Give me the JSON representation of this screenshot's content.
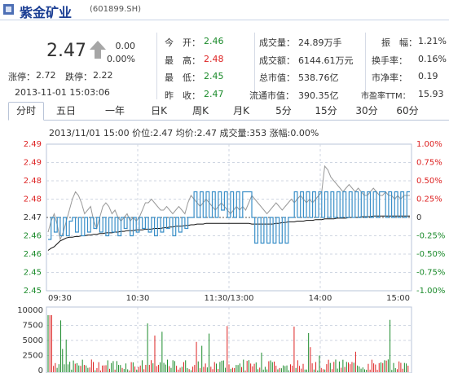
{
  "header": {
    "name": "紫金矿业",
    "code": "(601899.SH)"
  },
  "quote": {
    "price": "2.47",
    "change": "0.00",
    "change_pct": "0.00%",
    "limit_up_label": "涨停：",
    "limit_up": "2.72",
    "limit_down_label": "跌停：",
    "limit_down": "2.22",
    "datetime": "2013-11-01 15:03:06"
  },
  "stats_left": [
    {
      "label": "今　开：",
      "value": "2.46",
      "color": "green"
    },
    {
      "label": "最　高：",
      "value": "2.48",
      "color": "red"
    },
    {
      "label": "最　低：",
      "value": "2.45",
      "color": "green"
    },
    {
      "label": "昨　收：",
      "value": "2.47",
      "color": "green"
    }
  ],
  "stats_mid": [
    {
      "label": "成交量：",
      "value": "24.89万手"
    },
    {
      "label": "成交额：",
      "value": "6144.61万元"
    },
    {
      "label": "总市值：",
      "value": "538.76亿"
    },
    {
      "label": "流通市值：",
      "value": "390.35亿"
    }
  ],
  "stats_right": [
    {
      "label": "振　幅：",
      "value": "1.21%"
    },
    {
      "label": "换手率：",
      "value": "0.16%"
    },
    {
      "label": "市净率：",
      "value": "0.19"
    },
    {
      "label": "市盈率TTM：",
      "value": "15.93"
    }
  ],
  "tabs": [
    "分时",
    "五日",
    "一年",
    "日K",
    "周K",
    "月K",
    "5分",
    "15分",
    "30分",
    "60分"
  ],
  "active_tab": 0,
  "info_line": "2013/11/01 15:00  价位:2.47  均价:2.47  成交量:353  涨幅:0.00%",
  "colors": {
    "up": "#dd2222",
    "down": "#1a8a2a",
    "price_line": "#3a8fc8",
    "avg_line": "#111111",
    "prev_line": "#999999",
    "grid": "#cfd6e2"
  },
  "chart_data": [
    {
      "type": "line",
      "title": "",
      "x_ticks": [
        "09:30",
        "10:30",
        "11:30/13:00",
        "14:00",
        "15:00"
      ],
      "y_left_ticks": [
        "2.49",
        "2.49",
        "2.48",
        "2.48",
        "2.47",
        "2.46",
        "2.46",
        "2.45",
        "2.45"
      ],
      "y_right_ticks": [
        "1.00%",
        "0.75%",
        "0.50%",
        "0.25%",
        "0",
        "-0.25%",
        "-0.50%",
        "-0.75%",
        "-1.00%"
      ],
      "ylim_pct": [
        -1.0,
        1.0
      ],
      "baseline_price": 2.47,
      "series": [
        {
          "values_pct": [
            -0.3,
            0.0,
            -0.2,
            0.0,
            -0.25,
            0.0,
            -0.25,
            -0.05,
            0.0,
            -0.2,
            0.0,
            -0.25,
            0.0,
            -0.2,
            0.0,
            -0.15,
            0.0,
            -0.2,
            0.0,
            -0.25,
            0.0,
            -0.2,
            0.0,
            -0.25,
            0.0,
            -0.15,
            0.0,
            -0.25,
            0.0,
            -0.2,
            0.0,
            -0.15,
            0.0,
            -0.2,
            0.0,
            -0.25,
            0.0,
            -0.2,
            0.0,
            -0.15,
            0.0,
            -0.25,
            0.0,
            -0.2,
            0.0,
            -0.15,
            0.0,
            0.0,
            0.35,
            0.0,
            0.35,
            0.0,
            0.35,
            0.0,
            0.35,
            0.0,
            0.35,
            0.1,
            0.35,
            0.0,
            0.35,
            0.0,
            0.35,
            0.0,
            0.35,
            0.35,
            0.35,
            0.0,
            -0.35,
            0.0,
            -0.35,
            0.0,
            -0.35,
            0.0,
            -0.35,
            0.0,
            -0.35,
            0.0,
            -0.35,
            0.0,
            0.0,
            0.35,
            0.0,
            0.35,
            0.0,
            0.35,
            0.0,
            0.35,
            0.0,
            0.35,
            0.0,
            0.35,
            0.0,
            0.35,
            0.0,
            0.35,
            0.0,
            0.35,
            0.0,
            0.35,
            0.0,
            0.35,
            0.0,
            0.35,
            0.0,
            0.35,
            0.0,
            0.35,
            0.0,
            0.35,
            0.35,
            0.0,
            0.35,
            0.0,
            0.35,
            0.0,
            0.35,
            0.0,
            0.35,
            0.35
          ]
        },
        {
          "values_pct": [
            -0.45,
            -0.42,
            -0.4,
            -0.36,
            -0.32,
            -0.3,
            -0.28,
            -0.27,
            -0.27,
            -0.26,
            -0.26,
            -0.25,
            -0.25,
            -0.24,
            -0.24,
            -0.23,
            -0.23,
            -0.22,
            -0.22,
            -0.21,
            -0.21,
            -0.21,
            -0.2,
            -0.2,
            -0.19,
            -0.19,
            -0.18,
            -0.18,
            -0.18,
            -0.17,
            -0.17,
            -0.17,
            -0.16,
            -0.16,
            -0.16,
            -0.15,
            -0.15,
            -0.15,
            -0.14,
            -0.14,
            -0.13,
            -0.13,
            -0.12,
            -0.12,
            -0.12,
            -0.11,
            -0.11,
            -0.1,
            -0.1,
            -0.09,
            -0.09,
            -0.09,
            -0.08,
            -0.08,
            -0.08,
            -0.08,
            -0.08,
            -0.08,
            -0.08,
            -0.08,
            -0.08,
            -0.08,
            -0.08,
            -0.08,
            -0.08,
            -0.08,
            -0.08,
            -0.09,
            -0.09,
            -0.09,
            -0.09,
            -0.09,
            -0.09,
            -0.09,
            -0.09,
            -0.08,
            -0.08,
            -0.07,
            -0.07,
            -0.06,
            -0.06,
            -0.06,
            -0.05,
            -0.05,
            -0.05,
            -0.04,
            -0.04,
            -0.04,
            -0.03,
            -0.03,
            -0.03,
            -0.02,
            -0.02,
            -0.02,
            -0.02,
            -0.01,
            -0.01,
            -0.01,
            -0.01,
            0.0,
            0.0,
            0.0,
            0.0,
            0.01,
            0.01,
            0.01,
            0.01,
            0.02,
            0.02,
            0.02,
            0.02,
            0.02,
            0.02,
            0.02,
            0.02,
            0.02,
            0.02,
            0.02,
            0.02,
            0.02
          ]
        },
        {
          "values_pct": [
            -0.2,
            -0.05,
            0.05,
            -0.1,
            -0.3,
            -0.2,
            -0.05,
            0.1,
            0.25,
            0.35,
            0.3,
            0.2,
            0.05,
            0.1,
            0.15,
            -0.05,
            -0.15,
            0.0,
            0.15,
            0.2,
            0.15,
            0.05,
            0.1,
            0.0,
            -0.05,
            0.0,
            0.05,
            -0.05,
            0.0,
            -0.05,
            0.0,
            0.1,
            0.2,
            0.2,
            0.25,
            0.2,
            0.15,
            0.1,
            0.1,
            0.15,
            0.1,
            0.05,
            0.1,
            0.15,
            0.1,
            0.05,
            0.2,
            0.3,
            0.25,
            0.2,
            0.15,
            0.2,
            0.25,
            0.2,
            0.15,
            0.1,
            0.15,
            0.2,
            0.15,
            0.1,
            0.05,
            0.1,
            0.15,
            0.1,
            0.15,
            0.1,
            0.2,
            0.3,
            0.25,
            0.2,
            0.15,
            0.1,
            0.05,
            0.1,
            0.15,
            0.2,
            0.15,
            0.1,
            0.15,
            0.2,
            0.25,
            0.2,
            0.25,
            0.3,
            0.25,
            0.2,
            0.25,
            0.2,
            0.25,
            0.3,
            0.35,
            0.7,
            0.65,
            0.55,
            0.5,
            0.45,
            0.4,
            0.35,
            0.4,
            0.45,
            0.4,
            0.35,
            0.4,
            0.35,
            0.3,
            0.3,
            0.35,
            0.4,
            0.35,
            0.3,
            0.3,
            0.35,
            0.3,
            0.3,
            0.25,
            0.3,
            0.25,
            0.3,
            0.3,
            0.3
          ]
        }
      ]
    },
    {
      "type": "bar",
      "title": "",
      "y_ticks": [
        "10000",
        "7500",
        "5000",
        "2500",
        "0"
      ],
      "ylim": [
        0,
        10000
      ]
    }
  ]
}
